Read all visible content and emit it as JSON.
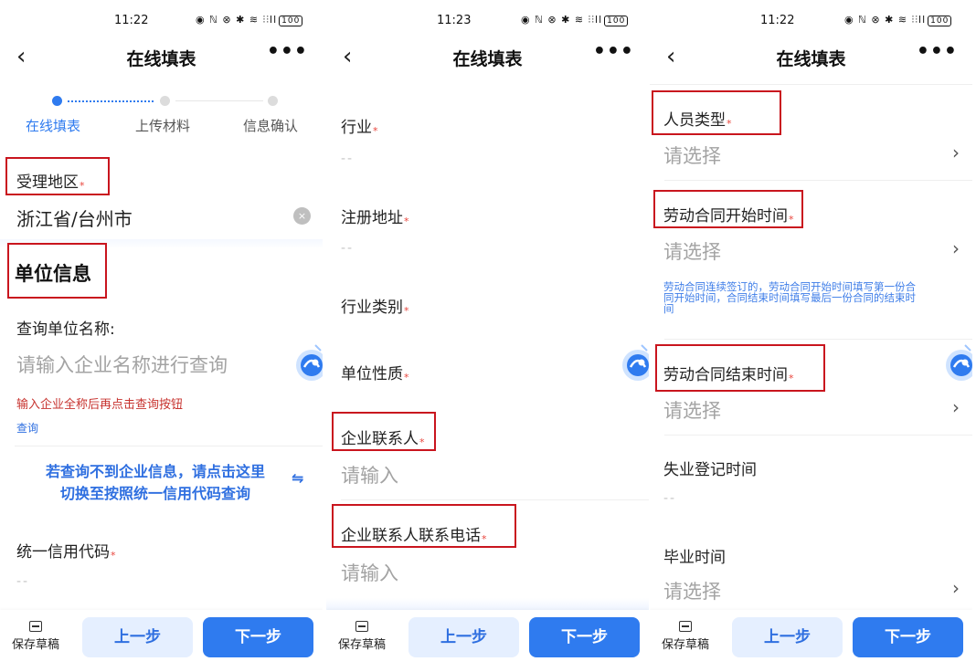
{
  "panels": [
    {
      "status": {
        "time": "11:22",
        "icons": "◉ ℕ ⊗ ✱ ≋ ⫶⫶ll",
        "battery": "100"
      },
      "header": {
        "back": "‹",
        "title": "在线填表",
        "more": "•••"
      },
      "steps": [
        {
          "label": "在线填表",
          "state": "active"
        },
        {
          "label": "上传材料",
          "state": "inactive"
        },
        {
          "label": "信息确认",
          "state": "inactive"
        }
      ],
      "region": {
        "label": "受理地区",
        "required": "*",
        "value": "浙江省/台州市",
        "clear": "×"
      },
      "section_title": "单位信息",
      "query": {
        "label": "查询单位名称:",
        "placeholder": "请输入企业名称进行查询",
        "hint": "输入企业全称后再点击查询按钮",
        "link": "查询"
      },
      "switch": {
        "line1": "若查询不到企业信息，请点击这里",
        "line2": "切换至按照统一信用代码查询",
        "icon": "⇋"
      },
      "credit": {
        "label": "统一信用代码",
        "required": "*",
        "value": "--"
      },
      "bottom": {
        "draft": "保存草稿",
        "prev": "上一步",
        "next": "下一步"
      }
    },
    {
      "status": {
        "time": "11:23",
        "icons": "◉ ℕ ⊗ ✱ ≋ ⫶⫶ll",
        "battery": "100"
      },
      "header": {
        "back": "‹",
        "title": "在线填表",
        "more": "•••"
      },
      "fields": [
        {
          "label": "行业",
          "required": "*",
          "value": "--"
        },
        {
          "label": "注册地址",
          "required": "*",
          "value": "--"
        },
        {
          "label": "行业类别",
          "required": "*"
        },
        {
          "label": "单位性质",
          "required": "*"
        },
        {
          "label": "企业联系人",
          "required": "*",
          "placeholder": "请输入"
        },
        {
          "label": "企业联系人联系电话",
          "required": "*",
          "placeholder": "请输入"
        }
      ],
      "bottom": {
        "draft": "保存草稿",
        "prev": "上一步",
        "next": "下一步"
      }
    },
    {
      "status": {
        "time": "11:22",
        "icons": "◉ ℕ ⊗ ✱ ≋ ⫶⫶ll",
        "battery": "100"
      },
      "header": {
        "back": "‹",
        "title": "在线填表",
        "more": "•••"
      },
      "fields": [
        {
          "label": "人员类型",
          "required": "*",
          "placeholder": "请选择",
          "chevron": "›"
        },
        {
          "label": "劳动合同开始时间",
          "required": "*",
          "placeholder": "请选择",
          "chevron": "›"
        },
        {
          "label": "劳动合同结束时间",
          "required": "*",
          "placeholder": "请选择",
          "chevron": "›"
        },
        {
          "label": "失业登记时间",
          "value": "--"
        },
        {
          "label": "毕业时间",
          "placeholder": "请选择",
          "chevron": "›"
        }
      ],
      "contract_tip": {
        "line1": "劳动合同连续签订的，劳动合同开始时间填写第一份合",
        "line2": "同开始时间，合同结束时间填写最后一份合同的结束时",
        "line3": "间"
      },
      "bottom": {
        "draft": "保存草稿",
        "prev": "上一步",
        "next": "下一步"
      }
    }
  ],
  "colors": {
    "accent": "#2f7bef",
    "required": "#e8453c",
    "hint": "#c7332f",
    "annotation": "#c9151e"
  }
}
